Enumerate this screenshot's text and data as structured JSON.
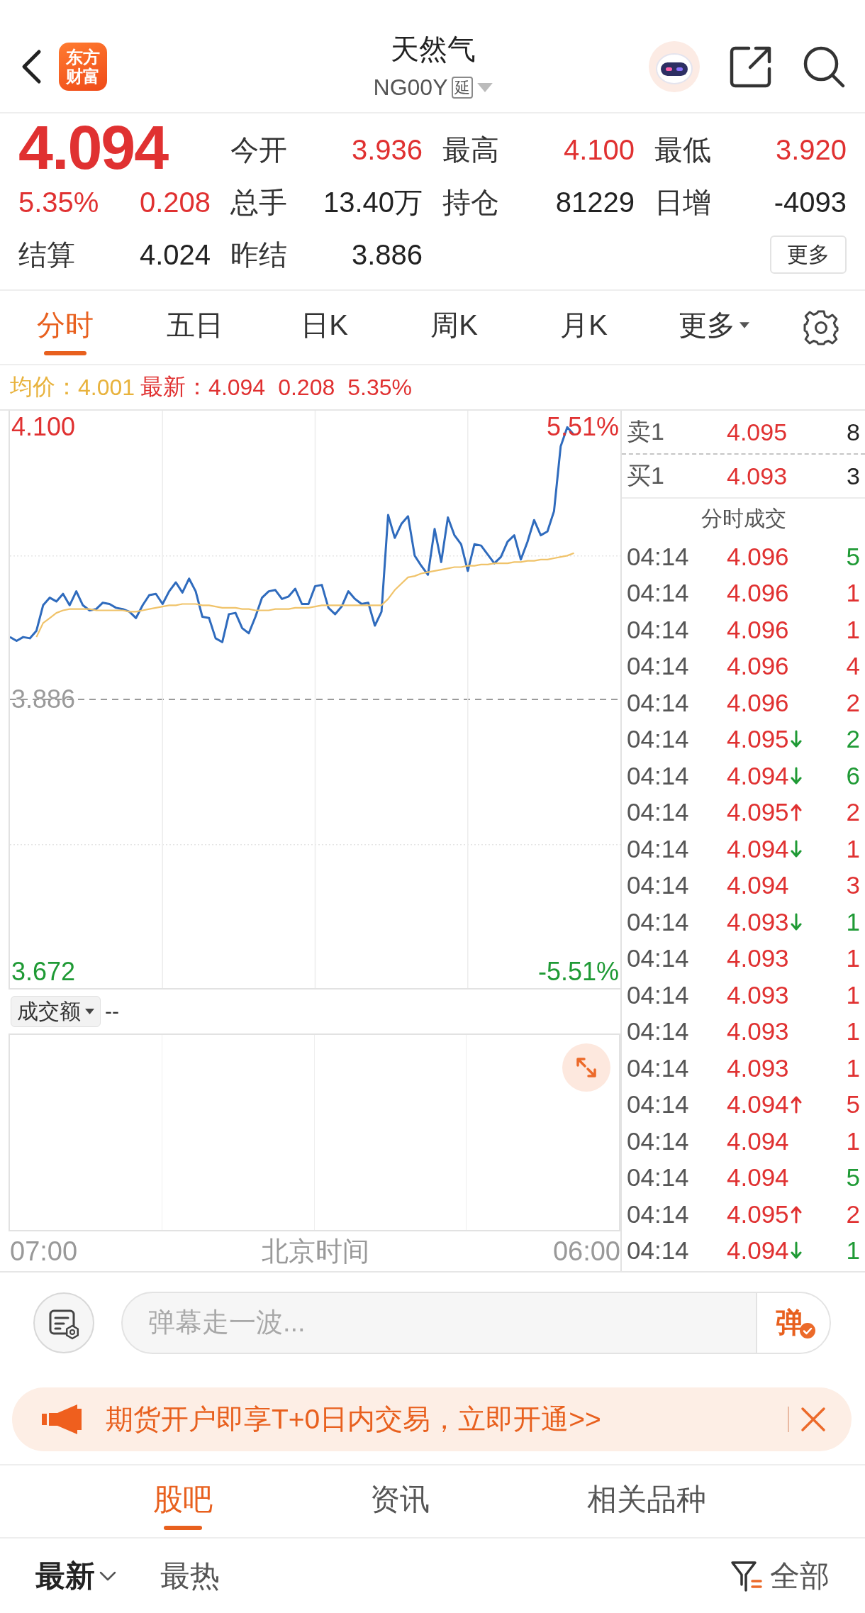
{
  "header": {
    "logo": "东方财富",
    "title": "天然气",
    "code": "NG00Y",
    "delay_badge": "延"
  },
  "quote": {
    "rising": true,
    "price": "4.094",
    "change_pct": "5.35%",
    "change": "0.208",
    "stats": [
      {
        "label": "今开",
        "value": "3.936",
        "color": "#e03131"
      },
      {
        "label": "最高",
        "value": "4.100",
        "color": "#e03131"
      },
      {
        "label": "最低",
        "value": "3.920",
        "color": "#e03131"
      },
      {
        "label": "总手",
        "value": "13.40万",
        "color": "#222222"
      },
      {
        "label": "持仓",
        "value": "81229",
        "color": "#222222"
      },
      {
        "label": "日增",
        "value": "-4093",
        "color": "#222222"
      },
      {
        "label": "结算",
        "value": "4.024",
        "color": "#222222"
      },
      {
        "label": "昨结",
        "value": "3.886",
        "color": "#222222"
      }
    ],
    "more_button": "更多"
  },
  "tabs": [
    {
      "label": "分时",
      "selected": true,
      "kind": "tab"
    },
    {
      "label": "五日",
      "selected": false,
      "kind": "tab"
    },
    {
      "label": "日K",
      "selected": false,
      "kind": "tab"
    },
    {
      "label": "周K",
      "selected": false,
      "kind": "tab"
    },
    {
      "label": "月K",
      "selected": false,
      "kind": "tab"
    },
    {
      "label": "更多",
      "selected": false,
      "kind": "menu"
    }
  ],
  "summary": {
    "avg_label": "均价：",
    "avg_value": "4.001",
    "latest_label": "最新：",
    "latest": "4.094",
    "change": "0.208",
    "change_pct": "5.35%",
    "rising": true
  },
  "chart": {
    "chart_data": {
      "type": "line",
      "categories": [
        null,
        null,
        null,
        null,
        null,
        null,
        null,
        null,
        null,
        null,
        null,
        null,
        null,
        null,
        null,
        null,
        null,
        null,
        null,
        null,
        null,
        null,
        null,
        null,
        null,
        null,
        null,
        null,
        null,
        null,
        null,
        null,
        null,
        null,
        null,
        null,
        null,
        null,
        null,
        null,
        null,
        null,
        null,
        null,
        null,
        null,
        null,
        null,
        null,
        null,
        null,
        null,
        null,
        null,
        null,
        null,
        null,
        null,
        null,
        null,
        null,
        null,
        null,
        null,
        null,
        null,
        null,
        null,
        null,
        null,
        null,
        null,
        null,
        null,
        null,
        null,
        null,
        null,
        null,
        null,
        null,
        null,
        null,
        null,
        null,
        null,
        null,
        null,
        null,
        null,
        null,
        null,
        null
      ],
      "ylim": [
        3.659,
        4.113
      ],
      "yticks": [
        {
          "value": 4.1,
          "label": "4.100"
        },
        {
          "value": 3.886,
          "label": "3.886"
        },
        {
          "value": 3.672,
          "label": "3.672"
        }
      ],
      "grid": true,
      "series": [
        {
          "color": "#2f6bbd",
          "values": [
            3.935,
            3.932,
            3.935,
            3.934,
            3.94,
            3.96,
            3.966,
            3.963,
            3.969,
            3.96,
            3.971,
            3.96,
            3.956,
            3.957,
            3.962,
            3.961,
            3.958,
            3.957,
            3.955,
            3.95,
            3.96,
            3.968,
            3.969,
            3.961,
            3.971,
            3.978,
            3.97,
            3.981,
            3.971,
            3.951,
            3.95,
            3.934,
            3.931,
            3.953,
            3.954,
            3.942,
            3.938,
            3.951,
            3.966,
            3.971,
            3.972,
            3.965,
            3.967,
            3.973,
            3.961,
            3.961,
            3.975,
            3.976,
            3.958,
            3.953,
            3.959,
            3.971,
            3.965,
            3.961,
            3.962,
            3.944,
            3.955,
            4.031,
            4.013,
            4.024,
            4.03,
            3.999,
            3.991,
            3.984,
            4.02,
            3.994,
            4.029,
            4.015,
            4.008,
            3.987,
            4.008,
            4.007,
            4.0,
            3.993,
            3.998,
            4.01,
            4.015,
            3.996,
            4.01,
            4.027,
            4.015,
            4.018,
            4.034,
            4.085,
            4.1,
            4.094,
            null,
            null,
            null,
            null,
            null,
            null,
            null
          ]
        },
        {
          "color": "#f0c36a",
          "values": [
            null,
            null,
            null,
            null,
            3.935,
            3.946,
            3.95,
            3.954,
            3.956,
            3.957,
            3.957,
            3.957,
            3.957,
            3.956,
            3.956,
            3.956,
            3.956,
            3.956,
            3.955,
            3.955,
            3.956,
            3.957,
            3.958,
            3.959,
            3.96,
            3.96,
            3.961,
            3.961,
            3.961,
            3.96,
            3.96,
            3.959,
            3.958,
            3.958,
            3.958,
            3.957,
            3.957,
            3.956,
            3.956,
            3.956,
            3.957,
            3.957,
            3.957,
            3.958,
            3.958,
            3.958,
            3.959,
            3.96,
            3.96,
            3.96,
            3.96,
            3.96,
            3.96,
            3.96,
            3.96,
            3.96,
            3.96,
            3.965,
            3.972,
            3.977,
            3.982,
            3.983,
            3.985,
            3.986,
            3.987,
            3.988,
            3.989,
            3.99,
            3.99,
            3.991,
            3.991,
            3.992,
            3.992,
            3.993,
            3.993,
            3.993,
            3.994,
            3.994,
            3.995,
            3.995,
            3.996,
            3.996,
            3.997,
            3.998,
            3.999,
            4.001,
            null,
            null,
            null,
            null,
            null,
            null,
            null
          ]
        }
      ]
    },
    "right_ticks": [
      "5.51%",
      "-5.51%"
    ]
  },
  "volume": {
    "selector": "成交额",
    "value": "--"
  },
  "time_axis": {
    "start": "07:00",
    "label": "北京时间",
    "end": "06:00"
  },
  "order_book": [
    {
      "label": "卖1",
      "price": "4.095",
      "volume": "8"
    },
    {
      "label": "买1",
      "price": "4.093",
      "volume": "3"
    }
  ],
  "trades_title": "分时成交",
  "trades": [
    {
      "time": "04:14",
      "price": "4.096",
      "kind": "plain",
      "volume": "5",
      "color": "#1f9a35"
    },
    {
      "time": "04:14",
      "price": "4.096",
      "kind": "plain",
      "volume": "1",
      "color": "#e03131"
    },
    {
      "time": "04:14",
      "price": "4.096",
      "kind": "plain",
      "volume": "1",
      "color": "#e03131"
    },
    {
      "time": "04:14",
      "price": "4.096",
      "kind": "plain",
      "volume": "4",
      "color": "#e03131"
    },
    {
      "time": "04:14",
      "price": "4.096",
      "kind": "plain",
      "volume": "2",
      "color": "#e03131"
    },
    {
      "time": "04:14",
      "price": "4.095",
      "kind": "down",
      "volume": "2",
      "color": "#1f9a35"
    },
    {
      "time": "04:14",
      "price": "4.094",
      "kind": "down",
      "volume": "6",
      "color": "#1f9a35"
    },
    {
      "time": "04:14",
      "price": "4.095",
      "kind": "up",
      "volume": "2",
      "color": "#e03131"
    },
    {
      "time": "04:14",
      "price": "4.094",
      "kind": "down",
      "volume": "1",
      "color": "#e03131"
    },
    {
      "time": "04:14",
      "price": "4.094",
      "kind": "plain",
      "volume": "3",
      "color": "#e03131"
    },
    {
      "time": "04:14",
      "price": "4.093",
      "kind": "down",
      "volume": "1",
      "color": "#1f9a35"
    },
    {
      "time": "04:14",
      "price": "4.093",
      "kind": "plain",
      "volume": "1",
      "color": "#e03131"
    },
    {
      "time": "04:14",
      "price": "4.093",
      "kind": "plain",
      "volume": "1",
      "color": "#e03131"
    },
    {
      "time": "04:14",
      "price": "4.093",
      "kind": "plain",
      "volume": "1",
      "color": "#e03131"
    },
    {
      "time": "04:14",
      "price": "4.093",
      "kind": "plain",
      "volume": "1",
      "color": "#e03131"
    },
    {
      "time": "04:14",
      "price": "4.094",
      "kind": "up",
      "volume": "5",
      "color": "#e03131"
    },
    {
      "time": "04:14",
      "price": "4.094",
      "kind": "plain",
      "volume": "1",
      "color": "#e03131"
    },
    {
      "time": "04:14",
      "price": "4.094",
      "kind": "plain",
      "volume": "5",
      "color": "#1f9a35"
    },
    {
      "time": "04:14",
      "price": "4.095",
      "kind": "up",
      "volume": "2",
      "color": "#e03131"
    },
    {
      "time": "04:14",
      "price": "4.094",
      "kind": "down",
      "volume": "1",
      "color": "#1f9a35"
    }
  ],
  "comment_bar": {
    "placeholder": "弹幕走一波...",
    "send_label": "弹"
  },
  "banner": {
    "text": "期货开户即享T+0日内交易，立即开通>>"
  },
  "bottom_tabs": [
    {
      "label": "股吧",
      "selected": true
    },
    {
      "label": "资讯",
      "selected": false
    },
    {
      "label": "相关品种",
      "selected": false
    }
  ],
  "filters": {
    "sort_options": [
      {
        "label": "最新",
        "selected": true,
        "kind": "dropdown"
      },
      {
        "label": "最热",
        "selected": false,
        "kind": "option"
      }
    ],
    "scope": "全部"
  }
}
